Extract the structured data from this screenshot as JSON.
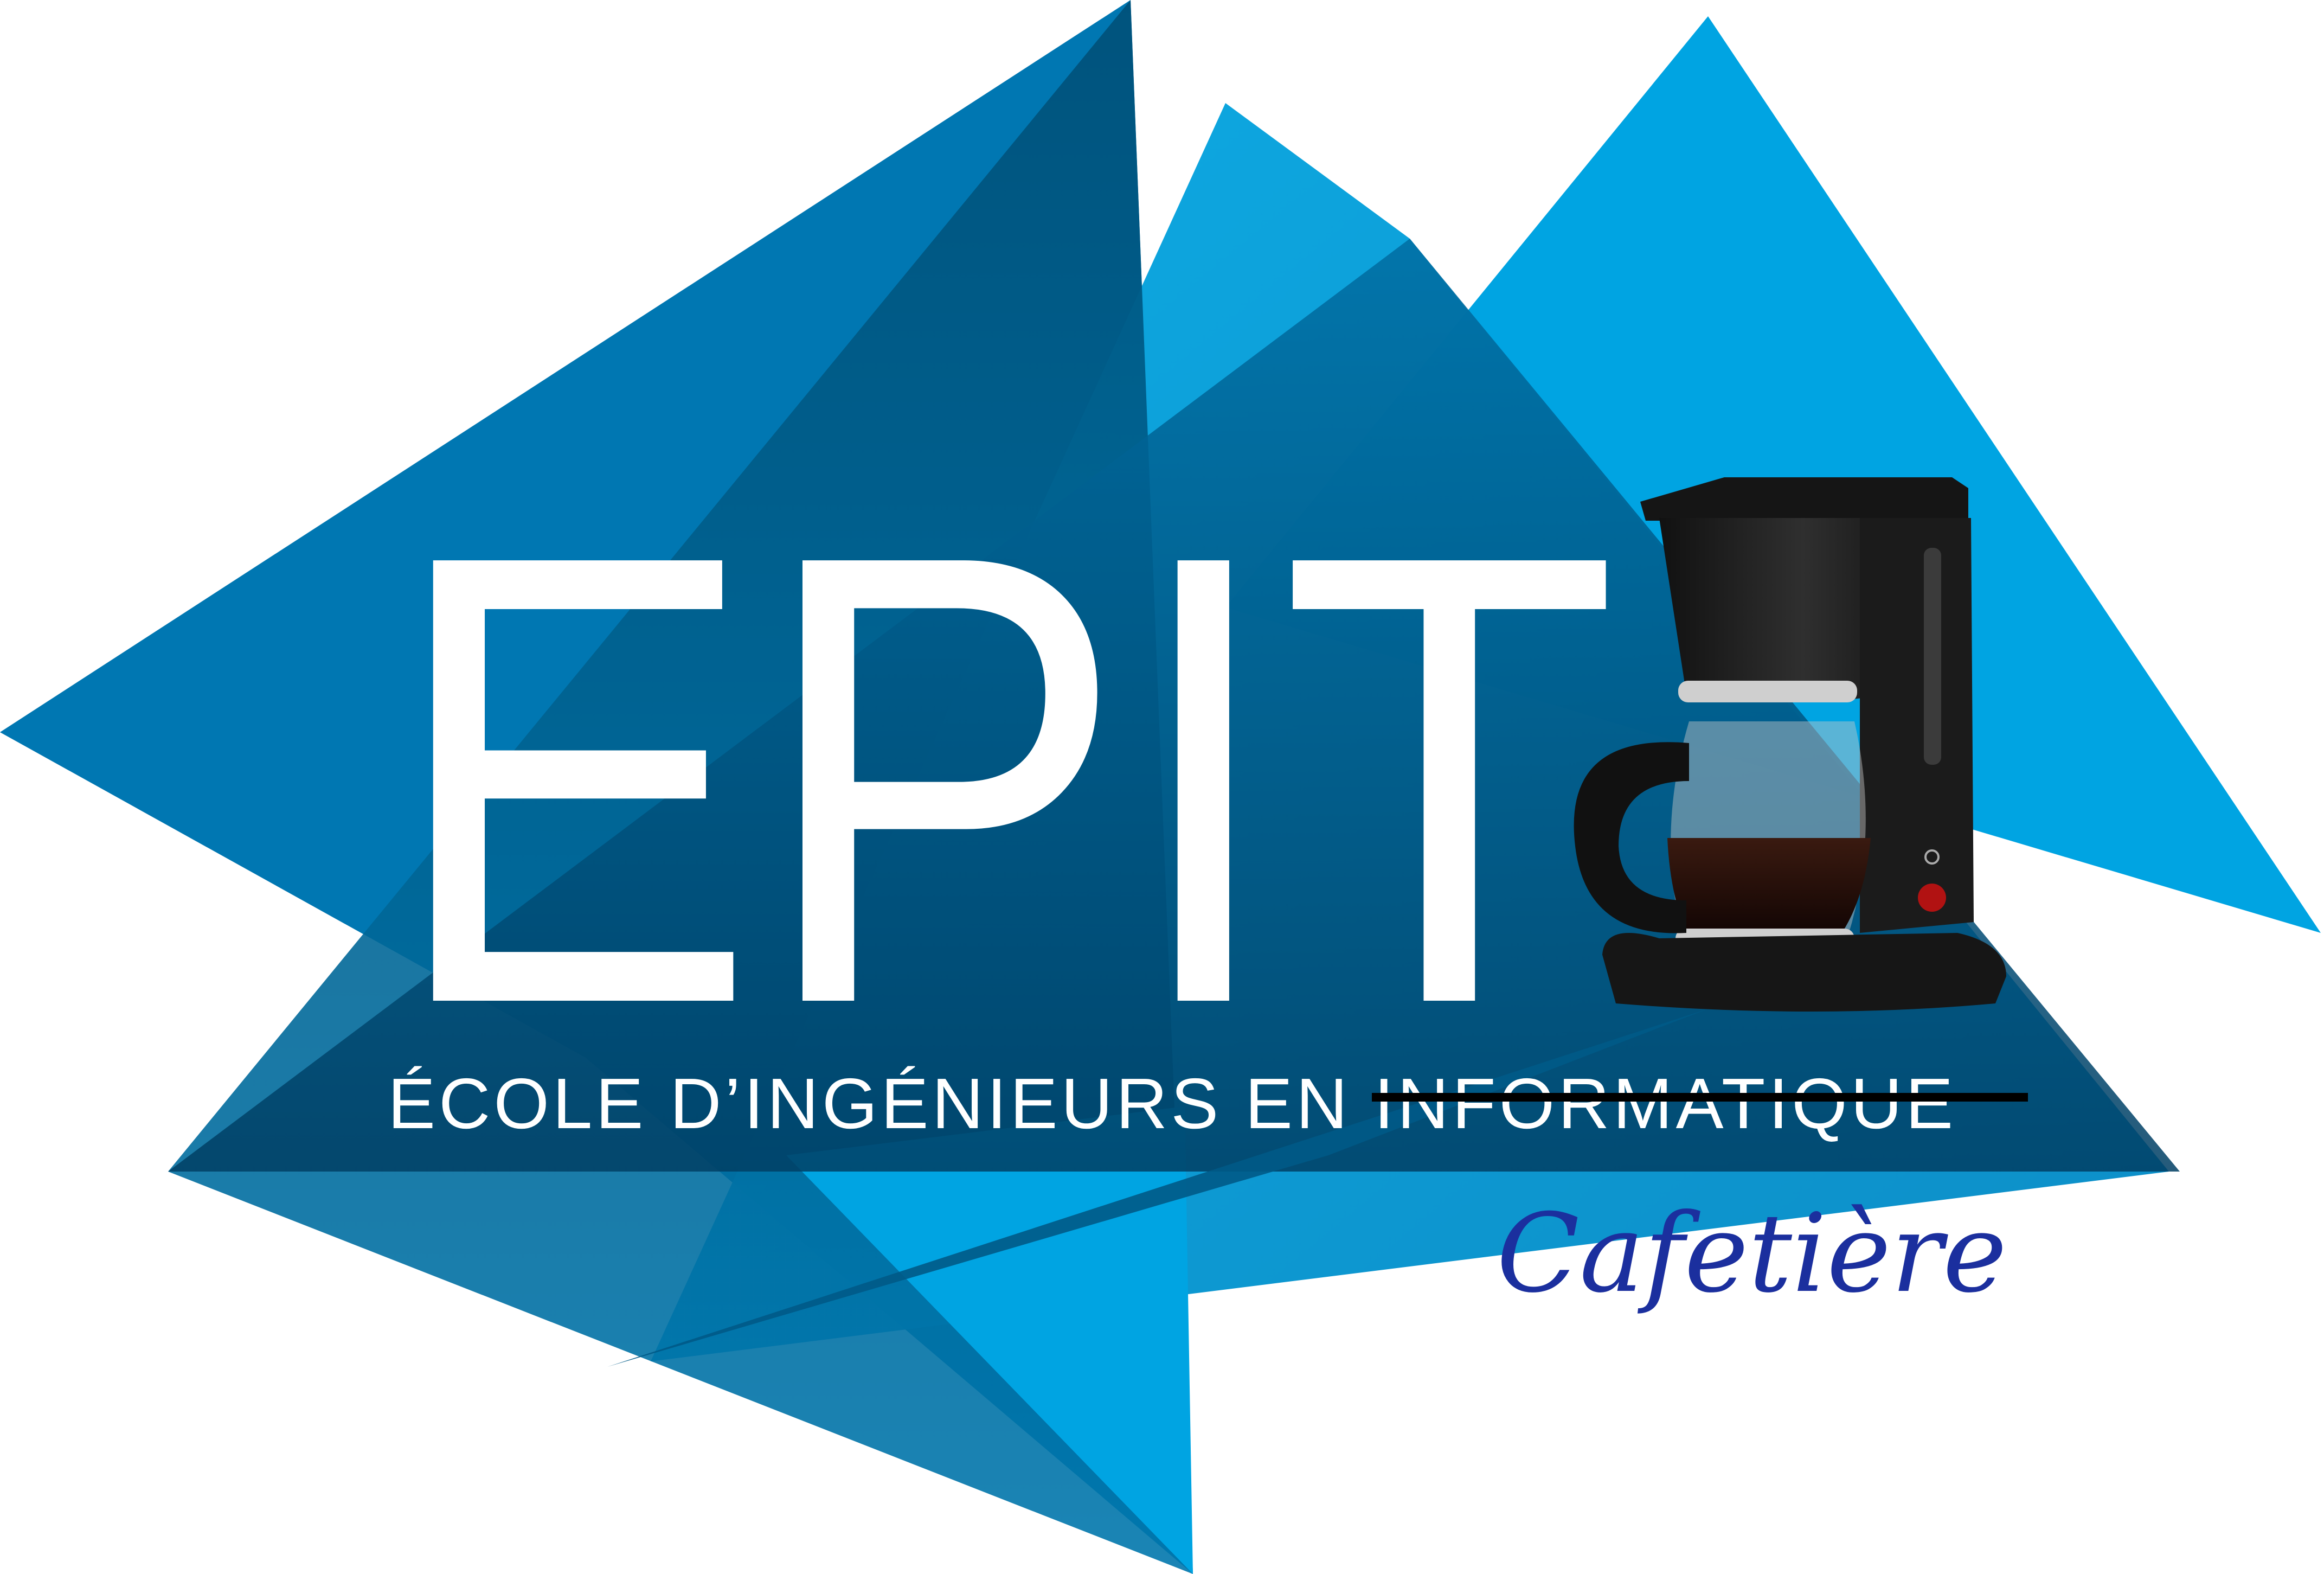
{
  "logo": {
    "wordmark": "EPIT",
    "tagline_kept": "ÉCOLE D’INGÉNIEURS EN ",
    "tagline_struck": "INFORMATIQUE",
    "subtitle": "Cafetière",
    "image_alt": "coffee-maker"
  },
  "colors": {
    "triangle_dark": "#005d8a",
    "triangle_mid": "#0080b8",
    "triangle_light": "#00a4e0",
    "text": "#ffffff",
    "subtitle": "#1b2f9e",
    "strike": "#000000"
  }
}
